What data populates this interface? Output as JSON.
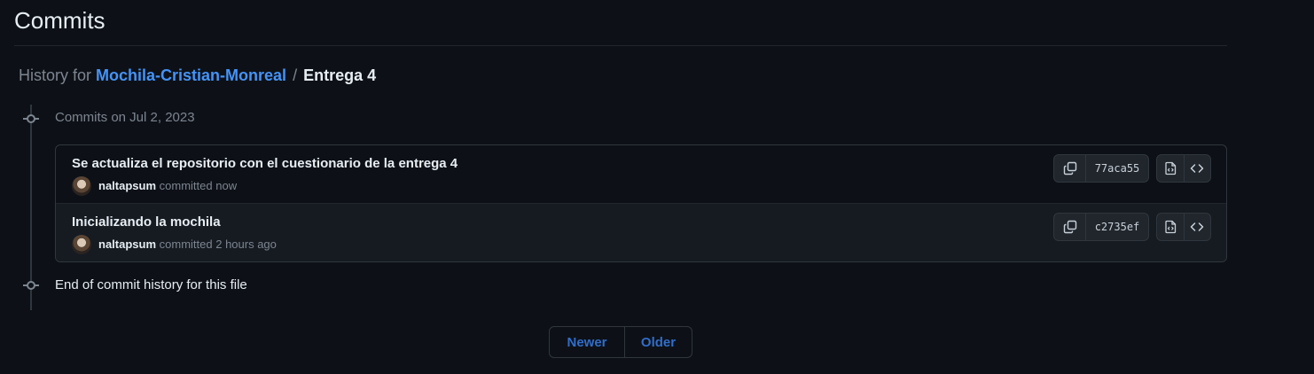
{
  "page": {
    "title": "Commits"
  },
  "history": {
    "prefix": "History for",
    "repo": "Mochila-Cristian-Monreal",
    "separator": "/",
    "path": "Entrega 4"
  },
  "timeline": {
    "date_label": "Commits on Jul 2, 2023",
    "end_label": "End of commit history for this file"
  },
  "commits": [
    {
      "message": "Se actualiza el repositorio con el cuestionario de la entrega 4",
      "author": "naltapsum",
      "action": "committed",
      "time": "now",
      "sha": "77aca55"
    },
    {
      "message": "Inicializando la mochila",
      "author": "naltapsum",
      "action": "committed",
      "time": "2 hours ago",
      "sha": "c2735ef"
    }
  ],
  "pagination": {
    "newer": "Newer",
    "older": "Older"
  },
  "icons": {
    "copy": "copy-icon",
    "file_code": "file-code-icon",
    "code": "code-icon",
    "commit_node": "git-commit-icon"
  },
  "colors": {
    "background": "#0d1117",
    "link": "#4493f8",
    "pagination_text": "#316dca",
    "muted": "#7d8590",
    "border": "#30363d"
  }
}
